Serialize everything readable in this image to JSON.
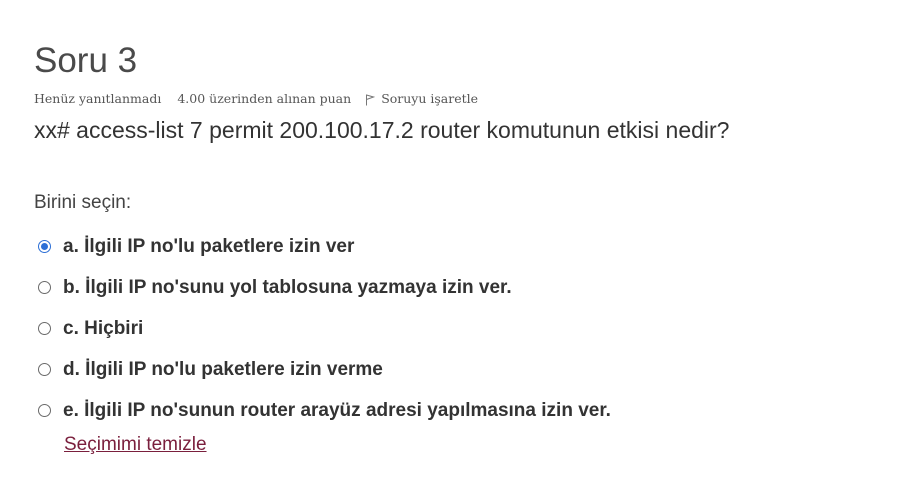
{
  "question": {
    "title": "Soru 3",
    "state": "Henüz yanıtlanmadı",
    "grade": "4.00 üzerinden alınan puan",
    "flag_label": "Soruyu işaretle",
    "text": "xx# access-list 7 permit 200.100.17.2 router komutunun etkisi nedir?"
  },
  "answers": {
    "prompt": "Birini seçin:",
    "options": [
      {
        "label": "a. İlgili IP no'lu paketlere izin ver",
        "selected": true
      },
      {
        "label": "b. İlgili IP no'sunu yol tablosuna yazmaya izin ver.",
        "selected": false
      },
      {
        "label": "c. Hiçbiri",
        "selected": false
      },
      {
        "label": "d. İlgili IP no'lu paketlere izin verme",
        "selected": false
      },
      {
        "label": "e. İlgili IP no'sunun router arayüz adresi yapılmasına izin ver.",
        "selected": false
      }
    ],
    "clear_label": "Seçimimi temizle"
  },
  "colors": {
    "accent": "#2c6fd6",
    "link": "#7a1f3d"
  }
}
